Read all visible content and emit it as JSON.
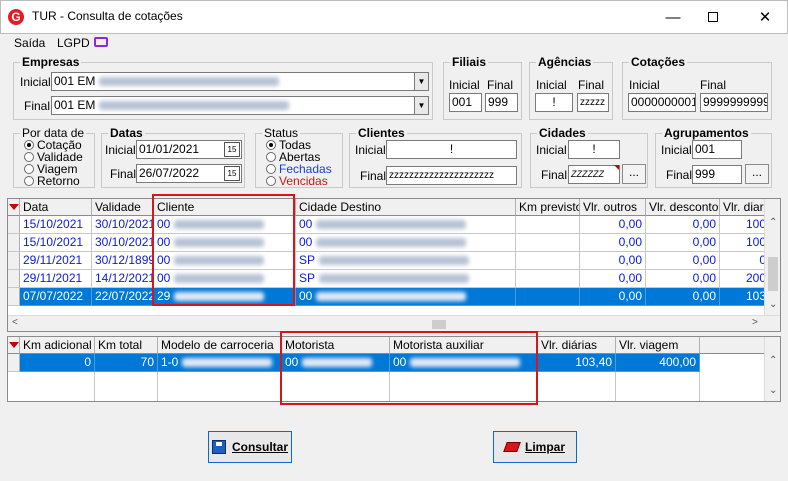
{
  "window": {
    "title": "TUR - Consulta de cotações",
    "icon": "G"
  },
  "menu": {
    "items": [
      "Saída",
      "LGPD"
    ]
  },
  "empresas": {
    "legend": "Empresas",
    "inicial_label": "Inicial",
    "inicial_value": "001 EM",
    "final_label": "Final",
    "final_value": "001 EM"
  },
  "filiais": {
    "legend": "Filiais",
    "inicial_label": "Inicial",
    "final_label": "Final",
    "inicial_value": "001",
    "final_value": "999"
  },
  "agencias": {
    "legend": "Agências",
    "inicial_label": "Inicial",
    "final_label": "Final",
    "inicial_value": "!",
    "final_value": "zzzzz"
  },
  "cotacoes": {
    "legend": "Cotações",
    "inicial_label": "Inicial",
    "final_label": "Final",
    "inicial_value": "0000000001",
    "final_value": "9999999999"
  },
  "por_data": {
    "legend": "Por data de",
    "options": [
      "Cotação",
      "Validade",
      "Viagem",
      "Retorno"
    ],
    "selected": 0
  },
  "datas": {
    "legend": "Datas",
    "inicial_label": "Inicial",
    "inicial_value": "01/01/2021",
    "final_label": "Final",
    "final_value": "26/07/2022",
    "cal_icon": "15"
  },
  "status": {
    "legend": "Status",
    "options": [
      "Todas",
      "Abertas",
      "Fechadas",
      "Vencidas"
    ],
    "colors": [
      "#000000",
      "#000000",
      "#1a3fd6",
      "#d41414"
    ],
    "selected": 0
  },
  "clientes": {
    "legend": "Clientes",
    "inicial_label": "Inicial",
    "inicial_value": "!",
    "final_label": "Final",
    "final_value": "zzzzzzzzzzzzzzzzzzzzz"
  },
  "cidades": {
    "legend": "Cidades",
    "inicial_label": "Inicial",
    "inicial_value": "!",
    "final_label": "Final",
    "final_value": "ZZZZZZ",
    "dots": "..."
  },
  "agrupamentos": {
    "legend": "Agrupamentos",
    "inicial_label": "Inicial",
    "inicial_value": "001",
    "final_label": "Final",
    "final_value": "999",
    "dots": "..."
  },
  "grid1": {
    "headers": [
      "Data",
      "Validade",
      "Cliente",
      "Cidade Destino",
      "Km previsto",
      "Vlr. outros",
      "Vlr. desconto",
      "Vlr. diarias"
    ],
    "rows": [
      {
        "data": "15/10/2021",
        "validade": "30/10/2021",
        "cliente": "00",
        "cidade": "00",
        "km": "",
        "outros": "0,00",
        "desconto": "0,00",
        "diarias": "100"
      },
      {
        "data": "15/10/2021",
        "validade": "30/10/2021",
        "cliente": "00",
        "cidade": "00",
        "km": "",
        "outros": "0,00",
        "desconto": "0,00",
        "diarias": "100"
      },
      {
        "data": "29/11/2021",
        "validade": "30/12/1899",
        "cliente": "00",
        "cidade": "SP",
        "km": "",
        "outros": "0,00",
        "desconto": "0,00",
        "diarias": "0"
      },
      {
        "data": "29/11/2021",
        "validade": "14/12/2021",
        "cliente": "00",
        "cidade": "SP",
        "km": "",
        "outros": "0,00",
        "desconto": "0,00",
        "diarias": "200"
      },
      {
        "data": "07/07/2022",
        "validade": "22/07/2022",
        "cliente": "29",
        "cidade": "00",
        "km": "",
        "outros": "0,00",
        "desconto": "0,00",
        "diarias": "103"
      }
    ],
    "selected": 4
  },
  "grid2": {
    "headers": [
      "Km adicional",
      "Km total",
      "Modelo de carroceria",
      "Motorista",
      "Motorista auxiliar",
      "Vlr. diárias",
      "Vlr. viagem"
    ],
    "rows": [
      {
        "km_adicional": "0",
        "km_total": "70",
        "modelo": "1-0",
        "motorista": "00",
        "auxiliar": "00",
        "diarias": "103,40",
        "viagem": "400,00"
      }
    ]
  },
  "buttons": {
    "consultar": "Consultar",
    "limpar": "Limpar"
  },
  "colors": {
    "selection": "#0078d7",
    "link_text": "#0b1bd6",
    "highlight_box": "#d9141b"
  }
}
